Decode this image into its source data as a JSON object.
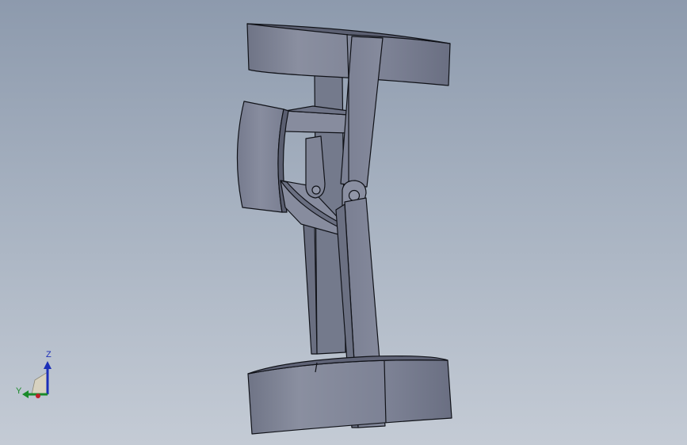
{
  "viewport": {
    "background_top": "#8d9aad",
    "background_bottom": "#c4cbd5",
    "part_color": "#7f8495",
    "edge_color": "#101218"
  },
  "triad": {
    "z_label": "Z",
    "y_label": "Y",
    "z_color": "#1c2fb8",
    "y_color": "#1a8a2a",
    "x_color": "#c0202a"
  },
  "model": {
    "description_icon": "knee-brace-model"
  }
}
